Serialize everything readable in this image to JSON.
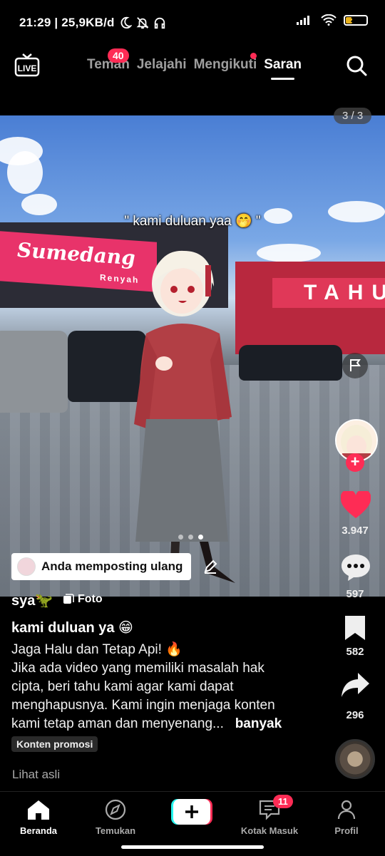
{
  "status_bar": {
    "time": "21:29 | 25,9KB/d",
    "battery": "20"
  },
  "top_nav": {
    "tabs": [
      {
        "label": "Teman"
      },
      {
        "label": "Jelajahi"
      },
      {
        "label": "Mengikuti"
      },
      {
        "label": "Saran"
      }
    ],
    "active_tab": "Saran",
    "teman_badge": "40",
    "live_label": "LIVE"
  },
  "media": {
    "counter": "3 / 3",
    "caption": "\" kami duluan yaa 🤭 \"",
    "sign_left": "Sumedang",
    "sign_left_sub": "Renyah",
    "sign_right": "TAHU",
    "page_dots": 3,
    "active_dot": 3,
    "repost_label": "Anda memposting ulang"
  },
  "right_rail": {
    "likes": "3.947",
    "comments": "597",
    "saves": "582",
    "shares": "296"
  },
  "post": {
    "username": "sya🦖",
    "type_label": "Foto",
    "title": "kami duluan ya 😁",
    "desc_line1": "Jaga Halu dan Tetap Api! 🔥",
    "desc_line2": "Jika ada video yang memiliki masalah hak",
    "desc_line3": "cipta, beri tahu kami agar kami dapat",
    "desc_line4": "menghapusnya. Kami ingin menjaga konten",
    "desc_line5": "kami tetap aman dan menyenang...",
    "more_label": "banyak",
    "promo_label": "Konten promosi",
    "view_original": "Lihat asli"
  },
  "bottom_nav": {
    "items": [
      {
        "label": "Beranda"
      },
      {
        "label": "Temukan"
      },
      {
        "label": "Kotak Masuk"
      },
      {
        "label": "Profil"
      }
    ],
    "inbox_badge": "11"
  },
  "colors": {
    "accent": "#fe2c55",
    "background": "#000000"
  }
}
